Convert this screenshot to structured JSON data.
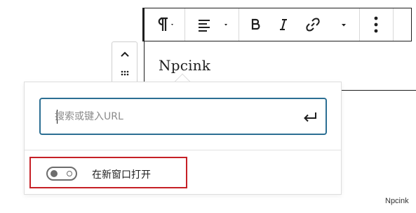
{
  "toolbar": {
    "paragraph_icon": "paragraph-icon",
    "align_icon": "align-left-icon",
    "bold_icon": "bold-icon",
    "italic_icon": "italic-icon",
    "link_icon": "link-icon",
    "more_icon": "more-vertical-icon"
  },
  "editor": {
    "paragraph_text": "Npcink"
  },
  "link_popover": {
    "url_placeholder": "搜索或键入URL",
    "url_value": "",
    "submit_icon": "enter-icon",
    "open_in_new_tab_label": "在新窗口打开",
    "open_in_new_tab_enabled": false
  },
  "watermark": "Npcink",
  "colors": {
    "focus_border": "#2c6f93",
    "highlight_border": "#c62026"
  }
}
